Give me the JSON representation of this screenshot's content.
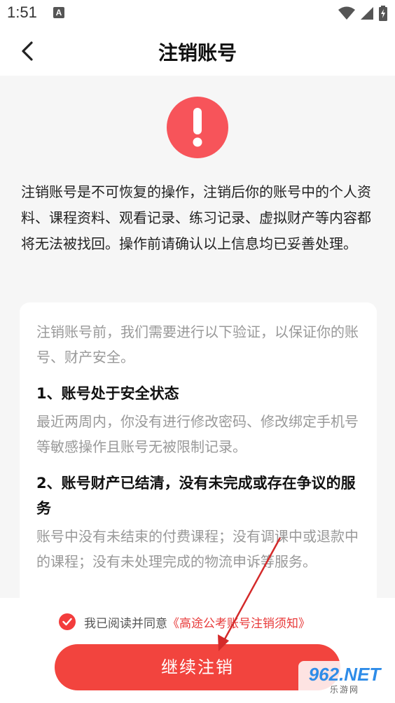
{
  "status_bar": {
    "time": "1:51",
    "notification_icon": "A",
    "icons": [
      "wifi-icon",
      "signal-icon",
      "battery-icon"
    ]
  },
  "nav": {
    "title": "注销账号",
    "back_icon": "chevron-left-icon"
  },
  "warning": {
    "icon": "exclamation-icon",
    "icon_color": "#f7545a",
    "text": "注销账号是不可恢复的操作，注销后你的账号中的个人资料、课程资料、观看记录、练习记录、虚拟财产等内容都将无法被找回。操作前请确认以上信息均已妥善处理。"
  },
  "card": {
    "intro": "注销账号前，我们需要进行以下验证，以保证你的账号、财产安全。",
    "sections": [
      {
        "title": "1、账号处于安全状态",
        "body": "最近两周内，你没有进行修改密码、修改绑定手机号等敏感操作且账号无被限制记录。"
      },
      {
        "title": "2、账号财产已结清，没有未完成或存在争议的服务",
        "body": "账号中没有未结束的付费课程；没有调课中或退款中的课程；没有未处理完成的物流申诉等服务。"
      }
    ]
  },
  "agreement": {
    "checked": true,
    "prefix": "我已阅读并同意",
    "link": "《高途公考账号注销须知》"
  },
  "continue_button": {
    "label": "继续注销",
    "color": "#f2443e"
  },
  "watermark": {
    "logo": "962.NET",
    "sub": "乐游网"
  }
}
